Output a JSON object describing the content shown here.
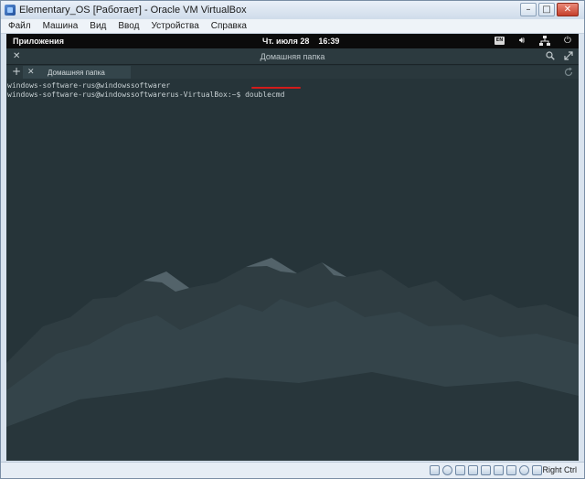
{
  "host_window": {
    "title": "Elementary_OS [Работает] - Oracle VM VirtualBox",
    "controls": {
      "minimize": "–",
      "maximize": "□",
      "close": "✕"
    },
    "menu": [
      "Файл",
      "Машина",
      "Вид",
      "Ввод",
      "Устройства",
      "Справка"
    ],
    "status": {
      "host_key": "Right Ctrl"
    }
  },
  "guest": {
    "topbar": {
      "applications": "Приложения",
      "date": "Чт. июля 28",
      "time": "16:39",
      "keyboard_indicator": "EN"
    },
    "terminal": {
      "title": "Домашняя папка",
      "tab_label": "Домашняя папка",
      "lines": [
        "windows-software-rus@windowssoftwarer",
        "windows-software-rus@windowssoftwarerus-VirtualBox:~$ "
      ],
      "command": "doublecmd"
    }
  },
  "colors": {
    "terminal_bg": "#263439",
    "panel_bg": "#0b0b0b",
    "highlight": "#d21b1b"
  }
}
